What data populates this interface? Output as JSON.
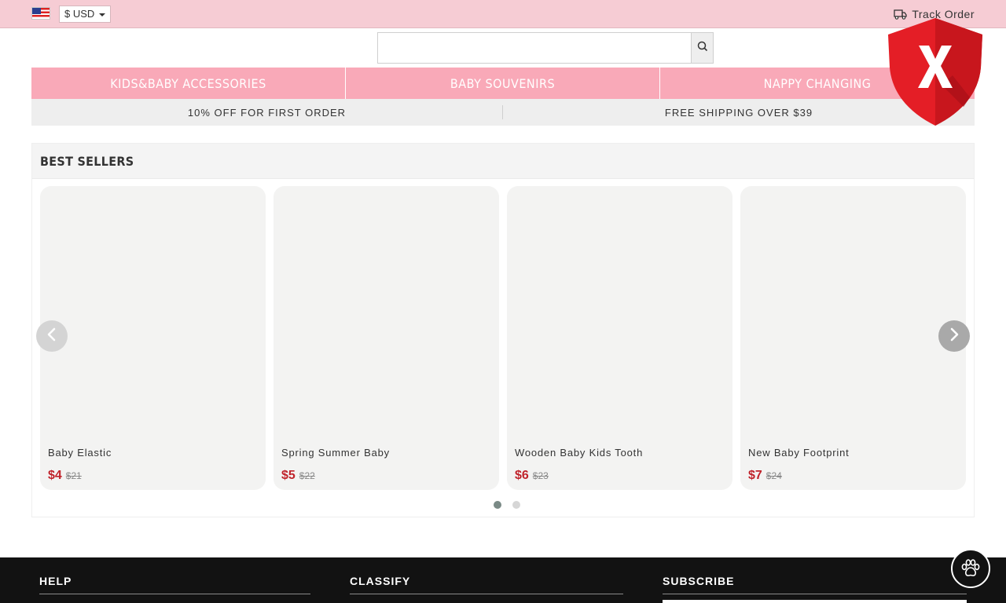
{
  "topbar": {
    "currency": "$  USD",
    "track_label": "Track Order"
  },
  "search": {
    "placeholder": ""
  },
  "nav": {
    "items": [
      {
        "label": "KIDS&BABY ACCESSORIES"
      },
      {
        "label": "BABY SOUVENIRS"
      },
      {
        "label": "NAPPY CHANGING"
      }
    ]
  },
  "promo": {
    "left": "10% OFF FOR FIRST ORDER",
    "right": "FREE SHIPPING OVER $39"
  },
  "best_sellers": {
    "title": "BEST SELLERS",
    "products": [
      {
        "name": "Baby Elastic",
        "price": "$4",
        "old_price": "$21"
      },
      {
        "name": "Spring Summer Baby",
        "price": "$5",
        "old_price": "$22"
      },
      {
        "name": "Wooden Baby Kids Tooth",
        "price": "$6",
        "old_price": "$23"
      },
      {
        "name": "New Baby Footprint",
        "price": "$7",
        "old_price": "$24"
      }
    ],
    "pagination": {
      "pages": 2,
      "active": 1
    }
  },
  "footer": {
    "help": "HELP",
    "classify": "CLASSIFY",
    "subscribe": "SUBSCRIBE"
  },
  "icons": {
    "flag": "us-flag-icon",
    "caret": "caret-down-icon",
    "truck": "truck-icon",
    "search": "search-icon",
    "prev": "chevron-left-icon",
    "next": "chevron-right-icon",
    "shield": "shield-x-icon",
    "paw": "paw-icon"
  },
  "colors": {
    "topbar": "#f6ccd4",
    "nav": "#f9a9b8",
    "price": "#c0232b",
    "footer": "#121212",
    "shield": "#e41e26"
  }
}
